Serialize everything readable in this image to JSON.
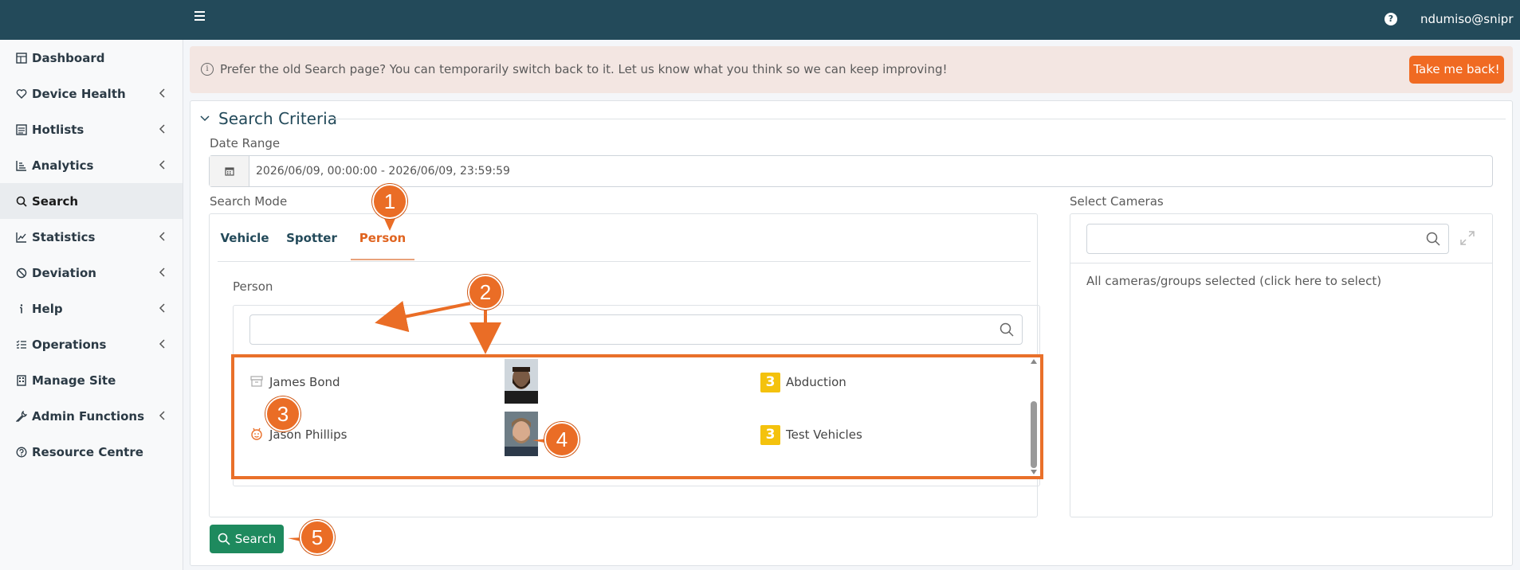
{
  "topbar": {
    "menu_icon": "hamburger-icon",
    "help_icon": "question-circle-icon",
    "help_glyph": "?",
    "user": "ndumiso@snipr"
  },
  "sidebar": {
    "items": [
      {
        "label": "Dashboard",
        "icon": "dashboard-icon",
        "has_children": false
      },
      {
        "label": "Device Health",
        "icon": "heart-pulse-icon",
        "has_children": true
      },
      {
        "label": "Hotlists",
        "icon": "list-icon",
        "has_children": true
      },
      {
        "label": "Analytics",
        "icon": "bar-chart-icon",
        "has_children": true
      },
      {
        "label": "Search",
        "icon": "search-icon",
        "has_children": false,
        "active": true
      },
      {
        "label": "Statistics",
        "icon": "line-chart-icon",
        "has_children": true
      },
      {
        "label": "Deviation",
        "icon": "ban-icon",
        "has_children": true
      },
      {
        "label": "Help",
        "icon": "info-icon",
        "has_children": true
      },
      {
        "label": "Operations",
        "icon": "checklist-icon",
        "has_children": true
      },
      {
        "label": "Manage Site",
        "icon": "building-icon",
        "has_children": false
      },
      {
        "label": "Admin Functions",
        "icon": "wrench-icon",
        "has_children": true
      },
      {
        "label": "Resource Centre",
        "icon": "help-circle-icon",
        "has_children": false
      }
    ]
  },
  "banner": {
    "icon": "info-icon",
    "icon_glyph": "i",
    "text": "Prefer the old Search page? You can temporarily switch back to it. Let us know what you think so we can keep improving!",
    "button": "Take me back!"
  },
  "search_criteria": {
    "title": "Search Criteria",
    "date_range_label": "Date Range",
    "date_range_value": "2026/06/09, 00:00:00 - 2026/06/09, 23:59:59",
    "search_mode_label": "Search Mode",
    "tabs": [
      {
        "label": "Vehicle",
        "active": false
      },
      {
        "label": "Spotter",
        "active": false
      },
      {
        "label": "Person",
        "active": true
      }
    ],
    "person_label": "Person",
    "person_search_value": "",
    "persons": [
      {
        "name": "James Bond",
        "status_icon": "archive-icon",
        "photo": "face-photo",
        "badge": "3",
        "group": "Abduction"
      },
      {
        "name": "Jason Phillips",
        "status_icon": "face-id-icon",
        "photo": "face-photo",
        "badge": "3",
        "group": "Test Vehicles"
      }
    ],
    "select_cameras_label": "Select Cameras",
    "camera_search_value": "",
    "cameras_text": "All cameras/groups selected (click here to select)",
    "search_button": "Search"
  },
  "callouts": [
    "1",
    "2",
    "3",
    "4",
    "5"
  ],
  "colors": {
    "topbar": "#234a5a",
    "accent_orange": "#ea6d26",
    "search_green": "#1e8a5e",
    "badge_yellow": "#f4c20d",
    "banner_bg": "#f3e6e2"
  }
}
